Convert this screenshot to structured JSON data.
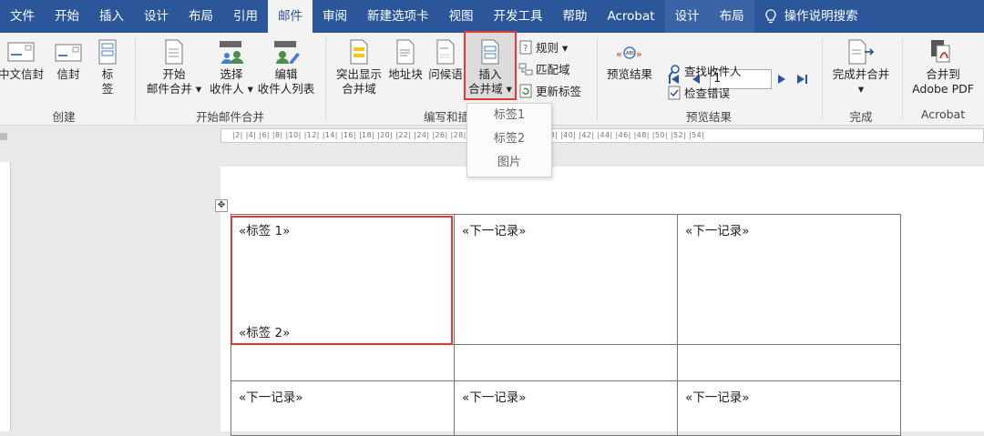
{
  "tabs": [
    "文件",
    "开始",
    "插入",
    "设计",
    "布局",
    "引用",
    "邮件",
    "审阅",
    "新建选项卡",
    "视图",
    "开发工具",
    "帮助",
    "Acrobat",
    "设计",
    "布局"
  ],
  "active_tab": "邮件",
  "tell_me": "操作说明搜索",
  "groups": {
    "create": {
      "label": "创建",
      "envelope_cn": "中文信封",
      "envelope": "信封",
      "labels": "标签"
    },
    "start": {
      "label": "开始邮件合并",
      "start_l1": "开始",
      "start_l2": "邮件合并 ▾",
      "select_l1": "选择",
      "select_l2": "收件人 ▾",
      "edit_l1": "编辑",
      "edit_l2": "收件人列表"
    },
    "write": {
      "label": "编写和插",
      "highlight_l1": "突出显示",
      "highlight_l2": "合并域",
      "address": "地址块",
      "greeting": "问候语",
      "insert_l1": "插入",
      "insert_l2": "合并域 ▾",
      "rules": "规则 ▾",
      "match": "匹配域",
      "update": "更新标签"
    },
    "preview": {
      "label": "预览结果",
      "preview_results": "预览结果",
      "record": "1",
      "find": "查找收件人",
      "check": "检查错误"
    },
    "finish": {
      "label": "完成",
      "finish_merge": "完成并合并",
      "arrow": "▾"
    },
    "acrobat": {
      "label": "Acrobat",
      "merge_l1": "合并到",
      "merge_l2": "Adobe PDF"
    }
  },
  "dropdown": [
    "标签1",
    "标签2",
    "图片"
  ],
  "ruler_text": "|2| |4| |6| |8| |10| |12| |14| |16| |18| |20| |22| |24| |26| |28| |30| |32| |34| |36| |38| |40| |42| |44| |46| |48| |50| |52| |54|",
  "table": {
    "row1": [
      "«标签 1»",
      "«下一记录»",
      "«下一记录»"
    ],
    "row1_sub": "«标签 2»",
    "row3": [
      "«下一记录»",
      "«下一记录»",
      "«下一记录»"
    ]
  },
  "colors": {
    "accent": "#2b579a",
    "highlight": "#e53935"
  }
}
